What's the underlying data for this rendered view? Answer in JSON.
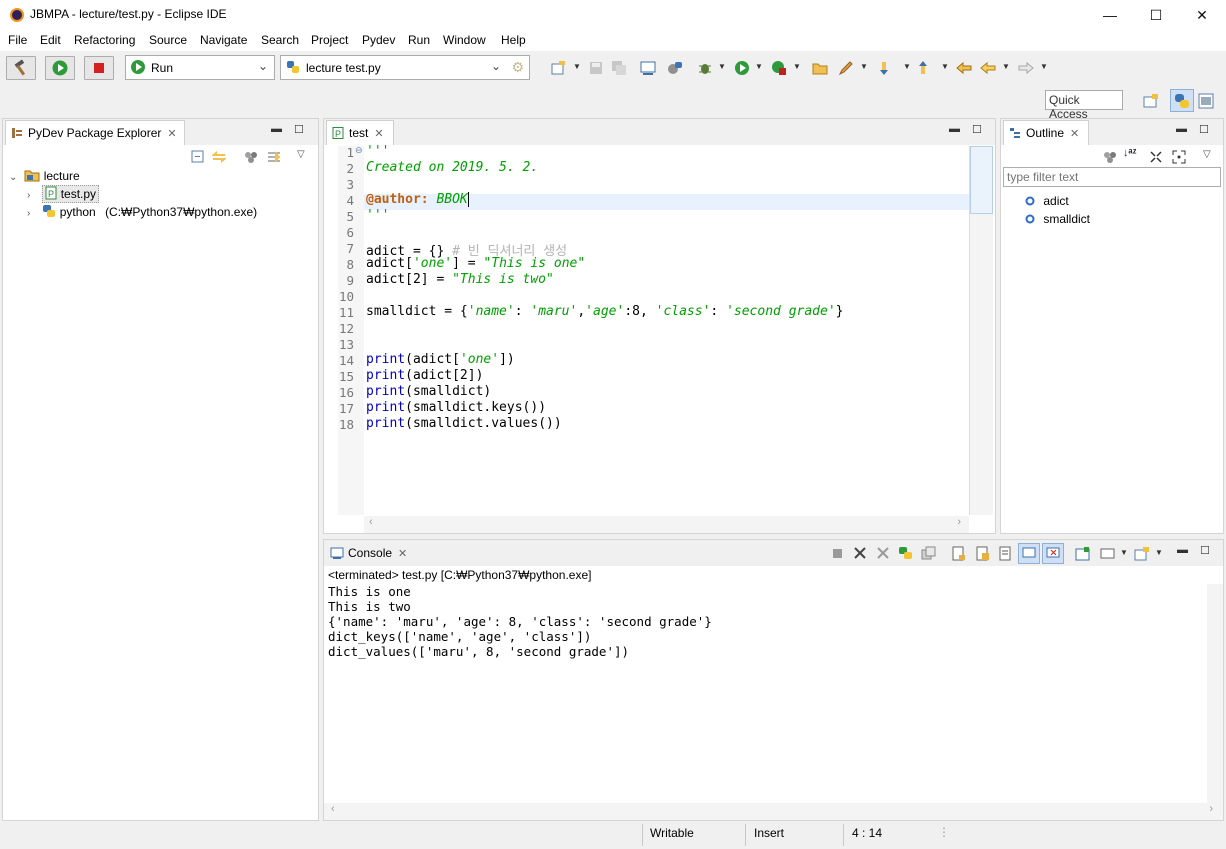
{
  "window": {
    "title": "JBMPA - lecture/test.py - Eclipse IDE",
    "minimize": "—",
    "maximize": "☐",
    "close": "✕"
  },
  "menu": [
    "File",
    "Edit",
    "Refactoring",
    "Source",
    "Navigate",
    "Search",
    "Project",
    "Pydev",
    "Run",
    "Window",
    "Help"
  ],
  "toolbar": {
    "run_config": "Run",
    "launch_target": "lecture test.py",
    "quick_access": "Quick Access"
  },
  "package_explorer": {
    "tab_title": "PyDev Package Explorer",
    "project": "lecture",
    "file": "test.py",
    "interpreter": "python",
    "interpreter_path": "(C:₩Python37₩python.exe)"
  },
  "editor": {
    "tab_title": "test",
    "line_numbers": [
      "1",
      "2",
      "3",
      "4",
      "5",
      "6",
      "7",
      "8",
      "9",
      "10",
      "11",
      "12",
      "13",
      "14",
      "15",
      "16",
      "17",
      "18"
    ],
    "lines": {
      "l1": "'''",
      "l2": "Created on 2019. 5. 2.",
      "l4_deco": "@author:",
      "l4_rest": " BBOK",
      "l5": "'''",
      "l7_code": "adict = {} ",
      "l7_comment": "# 빈 딕셔너리 생성",
      "l8_a": "adict[",
      "l8_b": "'one'",
      "l8_c": "] = ",
      "l8_d": "\"This is one\"",
      "l9_a": "adict[2] = ",
      "l9_b": "\"This is two\"",
      "l11_a": "smalldict = {",
      "l11_b": "'name'",
      "l11_c": ": ",
      "l11_d": "'maru'",
      "l11_e": ",",
      "l11_f": "'age'",
      "l11_g": ":8, ",
      "l11_h": "'class'",
      "l11_i": ": ",
      "l11_j": "'second grade'",
      "l11_k": "}",
      "l14_kw": "print",
      "l14_a": "(adict[",
      "l14_b": "'one'",
      "l14_c": "])",
      "l15_kw": "print",
      "l15_a": "(adict[2])",
      "l16_kw": "print",
      "l16_a": "(smalldict)",
      "l17_kw": "print",
      "l17_a": "(smalldict.keys())",
      "l18_kw": "print",
      "l18_a": "(smalldict.values())"
    }
  },
  "outline": {
    "tab_title": "Outline",
    "filter_placeholder": "type filter text",
    "items": [
      "adict",
      "smalldict"
    ]
  },
  "console": {
    "tab_title": "Console",
    "status": "<terminated> test.py [C:₩Python37₩python.exe]",
    "output": [
      "This is one",
      "This is two",
      "{'name': 'maru', 'age': 8, 'class': 'second grade'}",
      "dict_keys(['name', 'age', 'class'])",
      "dict_values(['maru', 8, 'second grade'])"
    ]
  },
  "statusbar": {
    "mode": "Writable",
    "insert": "Insert",
    "position": "4 : 14"
  },
  "colors": {
    "keyword": "#0000c0",
    "string": "#00a000",
    "comment": "#b4b4b4",
    "current_line": "#e8f2fe"
  }
}
